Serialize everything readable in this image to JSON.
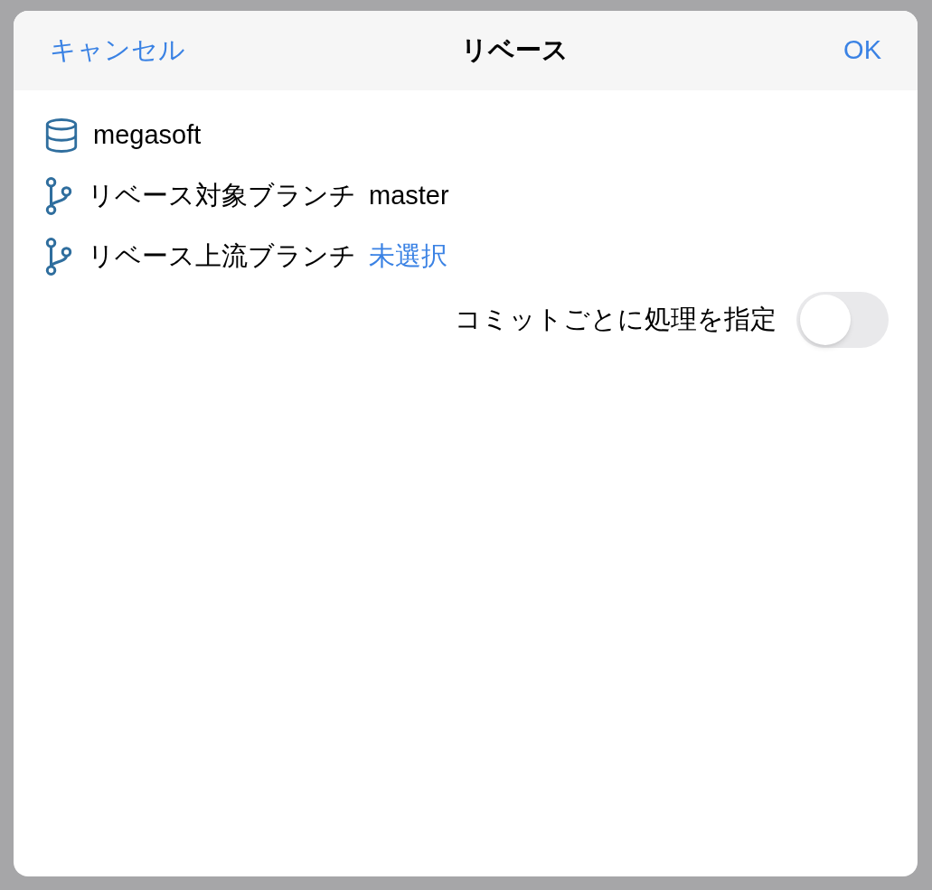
{
  "dialog": {
    "cancel": "キャンセル",
    "title": "リベース",
    "ok": "OK"
  },
  "rows": [
    {
      "kind": "repository",
      "label": "megasoft"
    },
    {
      "kind": "branch",
      "label": "リベース対象ブランチ",
      "value": "master",
      "value_link": false
    },
    {
      "kind": "branch",
      "label": "リベース上流ブランチ",
      "value": "未選択",
      "value_link": true
    }
  ],
  "option": {
    "label": "コミットごとに処理を指定",
    "on": false
  }
}
